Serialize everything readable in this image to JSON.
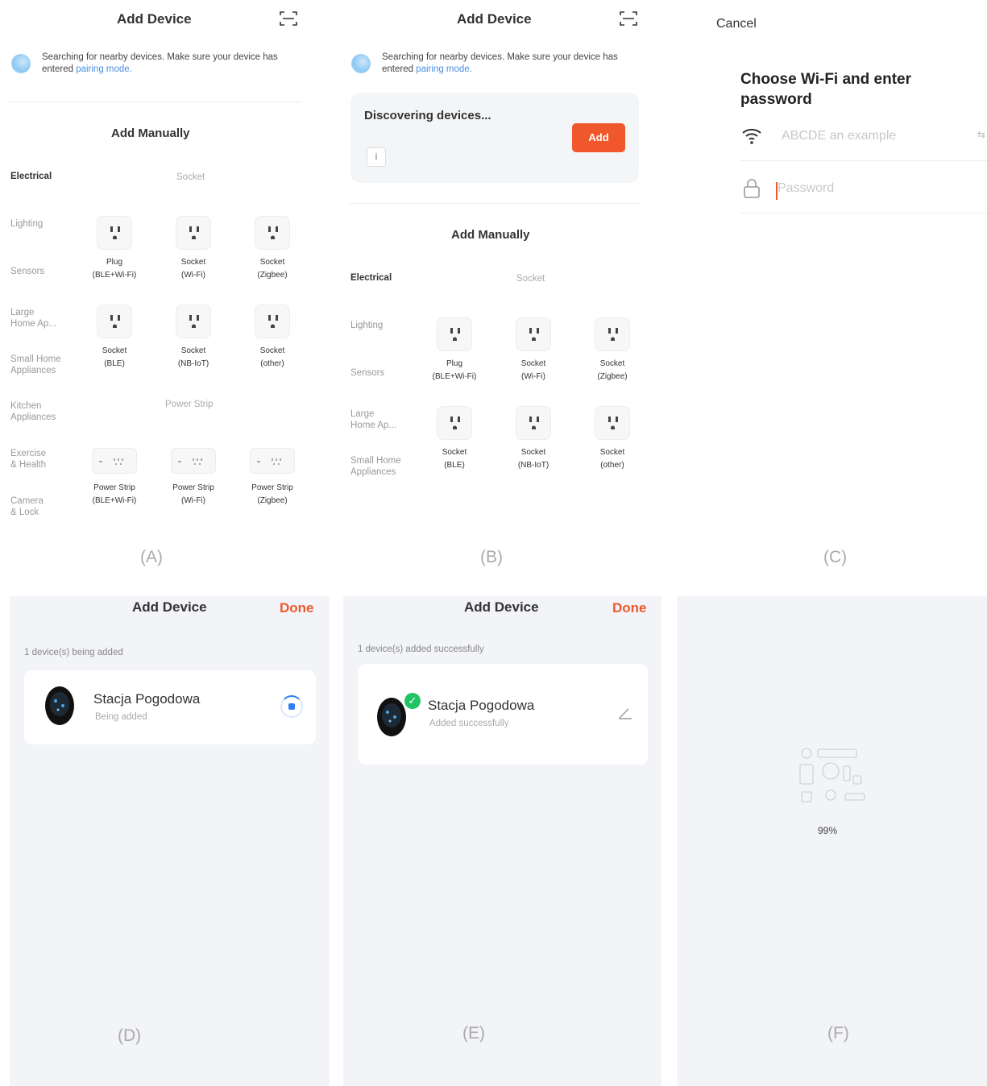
{
  "panel_a": {
    "title": "Add Device",
    "search_text": "Searching for nearby devices. Make sure your device has entered ",
    "search_link": "pairing mode.",
    "section_title": "Add Manually",
    "categories": [
      "Electrical",
      "Lighting",
      "Sensors",
      "Large\nHome Ap...",
      "Small Home\nAppliances",
      "Kitchen\nAppliances",
      "Exercise\n& Health",
      "Camera\n& Lock"
    ],
    "group_socket": "Socket",
    "group_strip": "Power Strip",
    "sockets": [
      {
        "name": "Plug",
        "sub": "(BLE+Wi-Fi)"
      },
      {
        "name": "Socket",
        "sub": "(Wi-Fi)"
      },
      {
        "name": "Socket",
        "sub": "(Zigbee)"
      },
      {
        "name": "Socket",
        "sub": "(BLE)"
      },
      {
        "name": "Socket",
        "sub": "(NB-IoT)"
      },
      {
        "name": "Socket",
        "sub": "(other)"
      }
    ],
    "strips": [
      {
        "name": "Power Strip",
        "sub": "(BLE+Wi-Fi)"
      },
      {
        "name": "Power Strip",
        "sub": "(Wi-Fi)"
      },
      {
        "name": "Power Strip",
        "sub": "(Zigbee)"
      }
    ],
    "caption": "(A)"
  },
  "panel_b": {
    "title": "Add Device",
    "search_text": "Searching for nearby devices. Make sure your device has entered ",
    "search_link": "pairing mode.",
    "discover_text": "Discovering devices...",
    "add_label": "Add",
    "info_glyph": "i",
    "section_title": "Add Manually",
    "categories": [
      "Electrical",
      "Lighting",
      "Sensors",
      "Large\nHome Ap...",
      "Small Home\nAppliances"
    ],
    "group_socket": "Socket",
    "sockets": [
      {
        "name": "Plug",
        "sub": "(BLE+Wi-Fi)"
      },
      {
        "name": "Socket",
        "sub": "(Wi-Fi)"
      },
      {
        "name": "Socket",
        "sub": "(Zigbee)"
      },
      {
        "name": "Socket",
        "sub": "(BLE)"
      },
      {
        "name": "Socket",
        "sub": "(NB-IoT)"
      },
      {
        "name": "Socket",
        "sub": "(other)"
      }
    ],
    "caption": "(B)"
  },
  "panel_c": {
    "cancel_label": "Cancel",
    "title": "Choose Wi-Fi and enter password",
    "wifi_placeholder": "ABCDE an example",
    "switch_glyph": "⇆",
    "password_placeholder": "Password",
    "caption": "(C)"
  },
  "panel_d": {
    "title": "Add Device",
    "done_label": "Done",
    "status": "1 device(s) being added",
    "device_name": "Stacja Pogodowa",
    "device_status": "Being added",
    "caption": "(D)"
  },
  "panel_e": {
    "title": "Add Device",
    "done_label": "Done",
    "status": "1 device(s) added successfully",
    "device_name": "Stacja Pogodowa",
    "device_status": "Added successfully",
    "check_glyph": "✓",
    "caption": "(E)"
  },
  "panel_f": {
    "progress": "99%",
    "caption": "(F)"
  },
  "colors": {
    "accent": "#f0582b",
    "link": "#4a90e2",
    "success": "#20c465",
    "spinner": "#2e7ef5"
  }
}
